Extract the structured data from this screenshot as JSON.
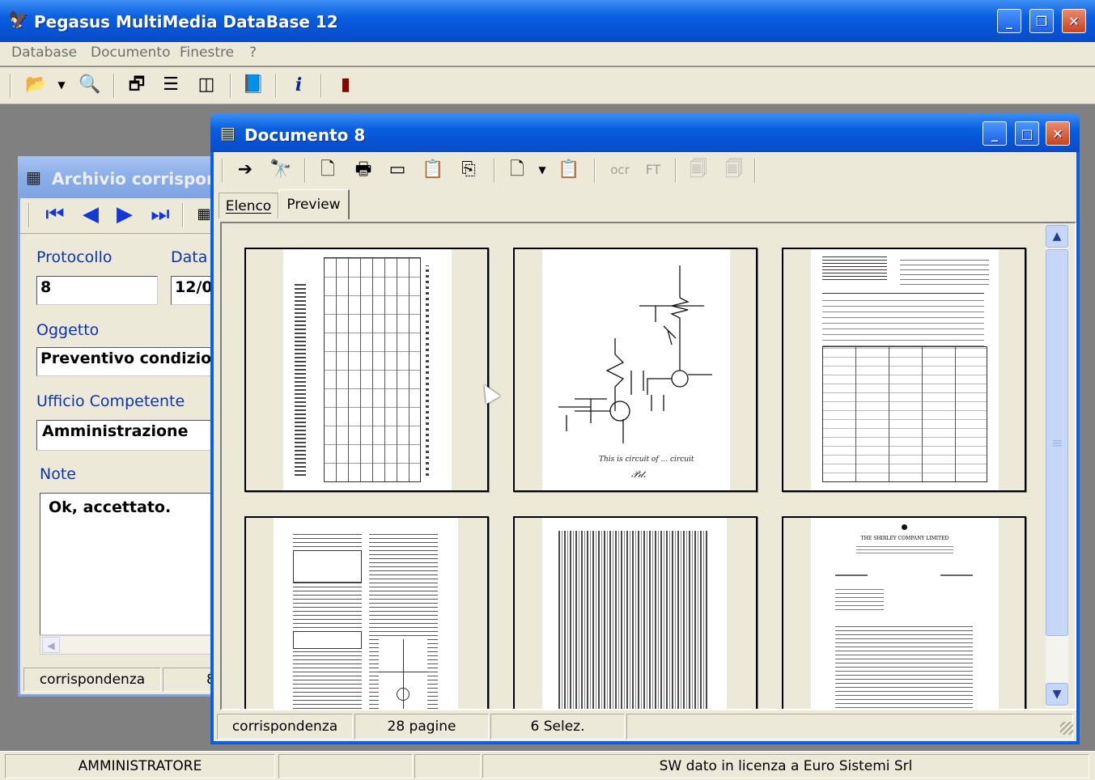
{
  "app": {
    "title": "Pegasus MultiMedia DataBase 12"
  },
  "menu": {
    "items": [
      "Database",
      "Documento",
      "Finestre",
      "?"
    ]
  },
  "toolbar_icons": [
    "open-folder-icon",
    "dropdown-arrow-icon",
    "search-key-icon",
    "cascade-windows-icon",
    "tile-horizontal-icon",
    "tile-vertical-icon",
    "book-icon",
    "info-icon",
    "exit-door-icon"
  ],
  "archive": {
    "title": "Archivio corrispon",
    "protocollo_label": "Protocollo",
    "protocollo_value": "8",
    "data_label": "Data",
    "data_value": "12/0",
    "oggetto_label": "Oggetto",
    "oggetto_value": "Preventivo condizio",
    "ufficio_label": "Ufficio Competente",
    "ufficio_value": "Amministrazione",
    "note_label": "Note",
    "note_value": "Ok, accettato.",
    "status": [
      "corrispondenza",
      "8"
    ]
  },
  "document": {
    "title": "Documento 8",
    "toolbar": {
      "ocr_label": "ocr",
      "ft_label": "FT"
    },
    "tabs": [
      "Elenco",
      "Preview"
    ],
    "active_tab": "Preview",
    "status": [
      "corrispondenza",
      "28 pagine",
      "6 Selez."
    ],
    "thumbnails": [
      "page-1-table",
      "page-2-circuit",
      "page-3-invoice",
      "page-4-article",
      "page-5-text",
      "page-6-letter"
    ],
    "circuit_caption": "This is circuit of ... circuit",
    "letter_heading": "THE SHIRLEY COMPANY LIMITED"
  },
  "statusbar": {
    "user": "AMMINISTRATORE",
    "license": "SW dato in licenza a Euro Sistemi Srl"
  },
  "colors": {
    "title_active": "#0a5fe0",
    "desktop": "#808080",
    "label_blue": "#0d33aa",
    "window_face": "#ece9d8"
  }
}
